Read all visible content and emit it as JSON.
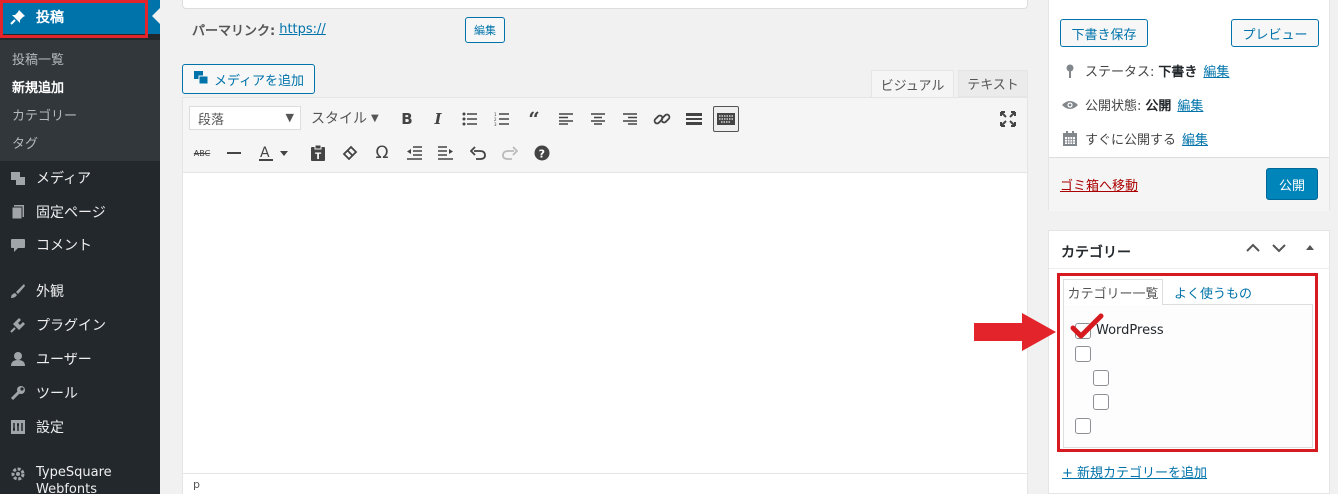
{
  "sidebar": {
    "active_item": {
      "label": "投稿",
      "icon": "pin-icon"
    },
    "submenu": [
      {
        "label": "投稿一覧"
      },
      {
        "label": "新規追加"
      },
      {
        "label": "カテゴリー"
      },
      {
        "label": "タグ"
      }
    ],
    "items": [
      {
        "label": "メディア",
        "icon": "media-icon"
      },
      {
        "label": "固定ページ",
        "icon": "page-icon"
      },
      {
        "label": "コメント",
        "icon": "comment-icon"
      },
      {
        "label": "外観",
        "icon": "brush-icon"
      },
      {
        "label": "プラグイン",
        "icon": "plugin-icon"
      },
      {
        "label": "ユーザー",
        "icon": "user-icon"
      },
      {
        "label": "ツール",
        "icon": "wrench-icon"
      },
      {
        "label": "設定",
        "icon": "settings-icon"
      },
      {
        "label": "TypeSquare Webfonts",
        "icon": "gear-icon"
      }
    ]
  },
  "editor": {
    "permalink_label": "パーマリンク:",
    "permalink_url": "https://",
    "permalink_edit": "編集",
    "add_media": "メディアを追加",
    "tab_visual": "ビジュアル",
    "tab_text": "テキスト",
    "format_select": "段落",
    "style_select": "スタイル",
    "path": "p"
  },
  "publish": {
    "save_draft": "下書き保存",
    "preview": "プレビュー",
    "status_label": "ステータス:",
    "status_value": "下書き",
    "visibility_label": "公開状態:",
    "visibility_value": "公開",
    "schedule_label": "すぐに公開する",
    "edit_link": "編集",
    "trash": "ゴミ箱へ移動",
    "publish": "公開"
  },
  "categories": {
    "title": "カテゴリー",
    "tab_all": "カテゴリー一覧",
    "tab_popular": "よく使うもの",
    "items": [
      {
        "label": "WordPress",
        "checked": true
      }
    ],
    "add_new": "+ 新規カテゴリーを追加"
  },
  "colors": {
    "sidebar_bg": "#23282d",
    "active": "#0073aa",
    "highlight_red": "#d71920",
    "link": "#0073aa",
    "trash": "#a00"
  }
}
